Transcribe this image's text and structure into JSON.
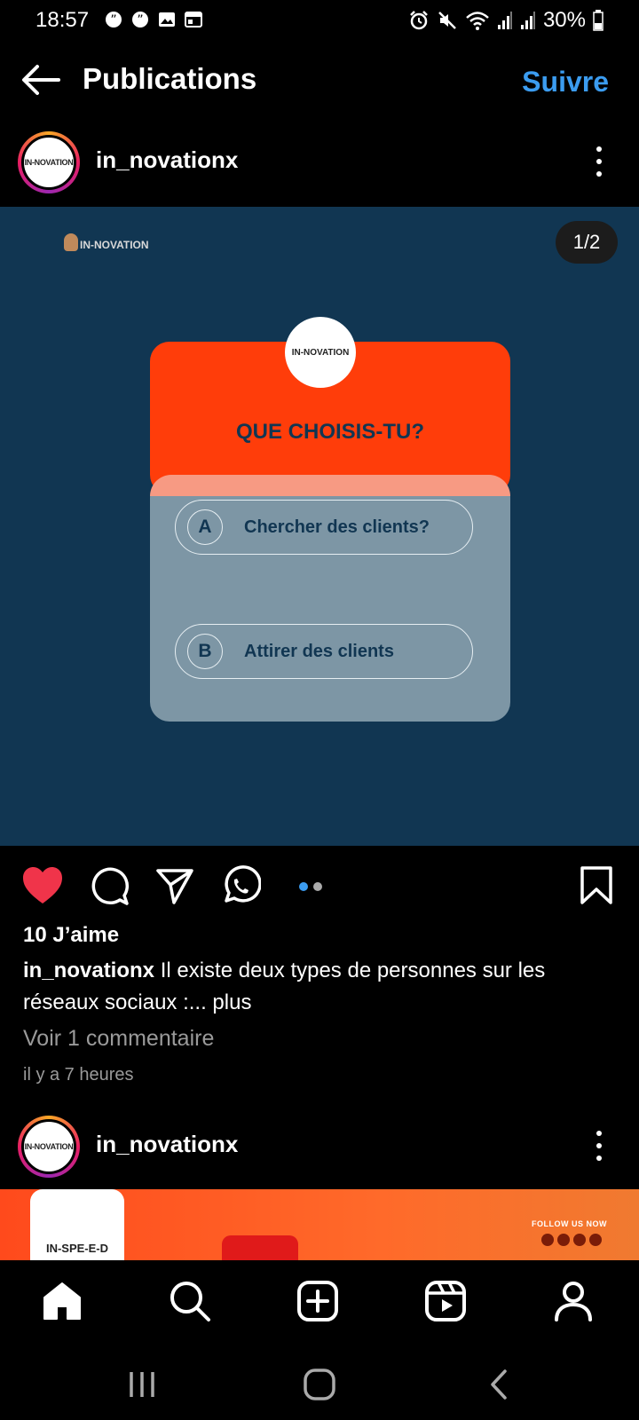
{
  "status_bar": {
    "time": "18:57",
    "battery": "30%",
    "left_icons": [
      "quote-icon",
      "quote-icon",
      "image-icon",
      "calendar-icon"
    ],
    "right_icons": [
      "alarm-icon",
      "mute-icon",
      "wifi-icon",
      "signal-icon",
      "signal-icon",
      "battery-icon"
    ]
  },
  "header": {
    "title": "Publications",
    "follow_label": "Suivre",
    "accent": "#3b9cf0"
  },
  "post": {
    "username": "in_novationx",
    "avatar_text": "IN-NOVATION",
    "image": {
      "logo_text": "IN-NOVATION",
      "counter": "1/2",
      "card_logo_text": "IN-NOVATION",
      "question": "QUE CHOISIS-TU?",
      "options": [
        {
          "letter": "A",
          "text": "Chercher des clients?"
        },
        {
          "letter": "B",
          "text": "Attirer des clients"
        }
      ],
      "colors": {
        "background": "#113652",
        "card_top": "#ff3d0a",
        "card_bottom": "#7d96a5"
      }
    },
    "carousel": {
      "count": 2,
      "active": 1
    },
    "likes": "10 J’aime",
    "caption_user": "in_novationx",
    "caption_text": " Il existe deux types de personnes sur les réseaux sociaux :...",
    "caption_more": " plus",
    "comments_link": "Voir 1 commentaire",
    "timestamp": "il y a 7 heures",
    "liked": true
  },
  "next_post": {
    "username": "in_novationx",
    "avatar_text": "IN-NOVATION",
    "banner_logo_text": "IN-SPE-E-D",
    "banner_follow_text": "FOLLOW US NOW"
  },
  "bottom_nav": [
    "home-icon",
    "search-icon",
    "create-icon",
    "reels-icon",
    "profile-icon"
  ],
  "system_nav": [
    "recent-apps-icon",
    "home-button-icon",
    "back-icon"
  ]
}
